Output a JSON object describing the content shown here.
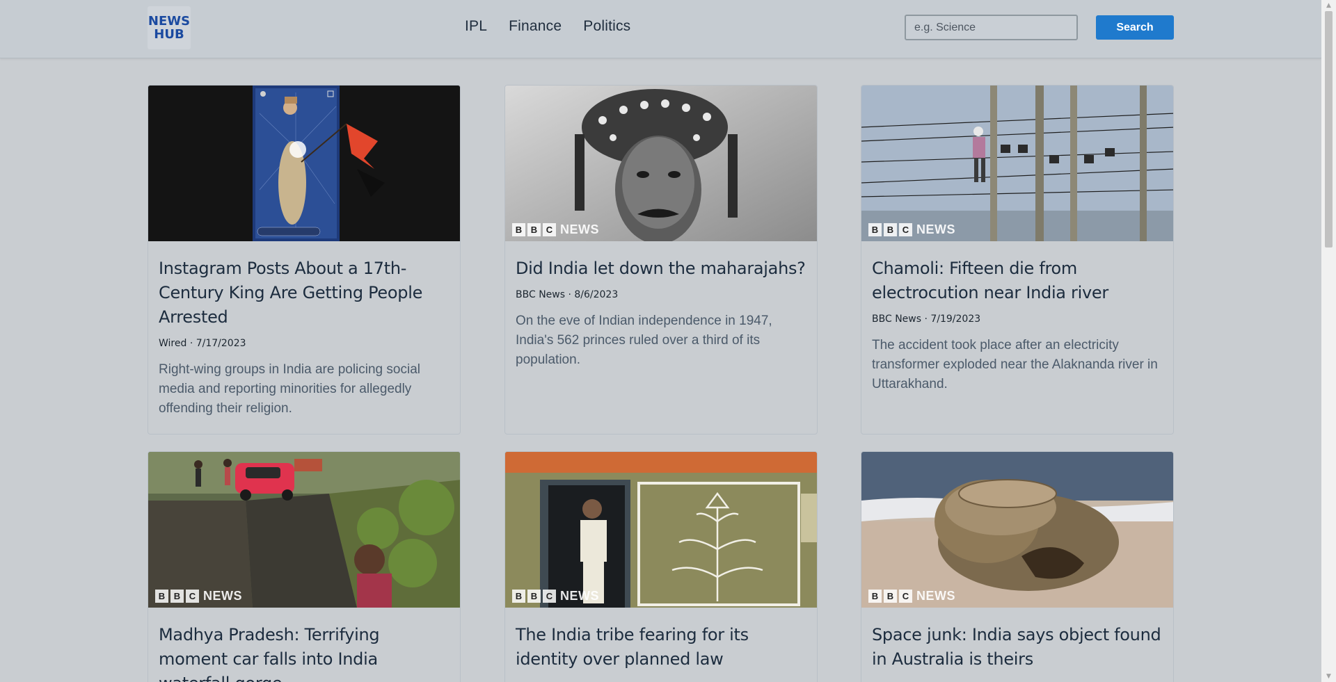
{
  "header": {
    "logo_line1": "NEWS",
    "logo_line2": "HUB",
    "nav": [
      "IPL",
      "Finance",
      "Politics"
    ],
    "search_placeholder": "e.g. Science",
    "search_label": "Search"
  },
  "bbc_badge": {
    "b1": "B",
    "b2": "B",
    "c": "C",
    "news": "NEWS"
  },
  "articles": [
    {
      "title": "Instagram Posts About a 17th-Century King Are Getting People Arrested",
      "meta": "Wired · 7/17/2023",
      "desc": "Right-wing groups in India are policing social media and reporting minorities for allegedly offending their religion."
    },
    {
      "title": "Did India let down the maharajahs?",
      "meta": "BBC News · 8/6/2023",
      "desc": "On the eve of Indian independence in 1947, India's 562 princes ruled over a third of its population."
    },
    {
      "title": "Chamoli: Fifteen die from electrocution near India river",
      "meta": "BBC News · 7/19/2023",
      "desc": "The accident took place after an electricity transformer exploded near the Alaknanda river in Uttarakhand."
    },
    {
      "title": "Madhya Pradesh: Terrifying moment car falls into India waterfall gorge",
      "meta": "",
      "desc": ""
    },
    {
      "title": "The India tribe fearing for its identity over planned law",
      "meta": "",
      "desc": ""
    },
    {
      "title": "Space junk: India says object found in Australia is theirs",
      "meta": "",
      "desc": ""
    }
  ]
}
